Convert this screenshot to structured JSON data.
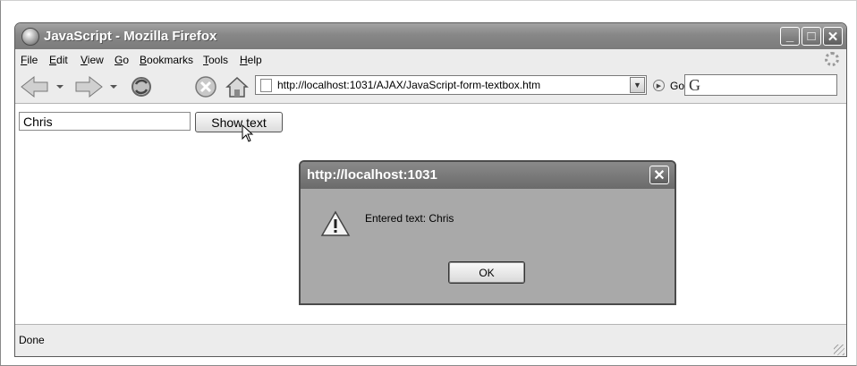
{
  "window": {
    "title": "JavaScript - Mozilla Firefox",
    "minimize_label": "_",
    "maximize_label": "□",
    "close_label": "✕"
  },
  "menubar": {
    "items": [
      "File",
      "Edit",
      "View",
      "Go",
      "Bookmarks",
      "Tools",
      "Help"
    ]
  },
  "navbar": {
    "url": "http://localhost:1031/AJAX/JavaScript-form-textbox.htm",
    "dropdown_glyph": "▼",
    "go_label": "Go",
    "search_engine_glyph": "G"
  },
  "page": {
    "text_field_value": "Chris",
    "show_button_label": "Show text"
  },
  "dialog": {
    "title": "http://localhost:1031",
    "close_glyph": "✕",
    "message": "Entered text: Chris",
    "ok_label": "OK"
  },
  "statusbar": {
    "text": "Done"
  },
  "icons": [
    "firefox-icon",
    "back-icon",
    "forward-icon",
    "reload-icon",
    "stop-icon",
    "home-icon",
    "page-icon",
    "go-icon",
    "search-engine-icon",
    "warning-icon",
    "cursor-icon"
  ]
}
